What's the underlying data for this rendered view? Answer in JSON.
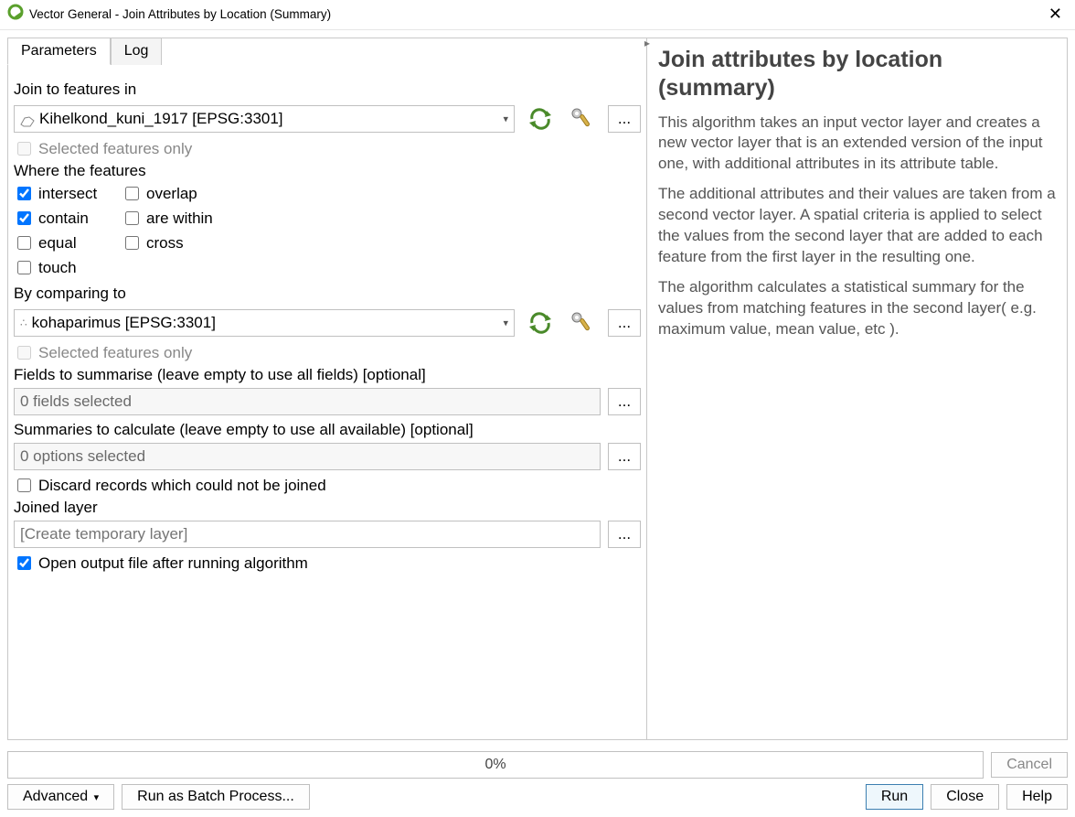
{
  "window": {
    "title": "Vector General - Join Attributes by Location (Summary)"
  },
  "tabs": {
    "parameters": "Parameters",
    "log": "Log",
    "active": "Parameters"
  },
  "left": {
    "join_to_label": "Join to features in",
    "join_to_value": "Kihelkond_kuni_1917 [EPSG:3301]",
    "selected_only_1": "Selected features only",
    "where_label": "Where the features",
    "predicates": {
      "intersect": {
        "label": "intersect",
        "checked": true
      },
      "overlap": {
        "label": "overlap",
        "checked": false
      },
      "contain": {
        "label": "contain",
        "checked": true
      },
      "are_within": {
        "label": "are within",
        "checked": false
      },
      "equal": {
        "label": "equal",
        "checked": false
      },
      "cross": {
        "label": "cross",
        "checked": false
      },
      "touch": {
        "label": "touch",
        "checked": false
      }
    },
    "compare_label": "By comparing to",
    "compare_value": "kohaparimus [EPSG:3301]",
    "selected_only_2": "Selected features only",
    "fields_label": "Fields to summarise (leave empty to use all fields) [optional]",
    "fields_value": "0 fields selected",
    "summaries_label": "Summaries to calculate (leave empty to use all available) [optional]",
    "summaries_value": "0 options selected",
    "discard_label": "Discard records which could not be joined",
    "joined_layer_label": "Joined layer",
    "joined_layer_placeholder": "[Create temporary layer]",
    "open_output_label": "Open output file after running algorithm"
  },
  "right": {
    "title": "Join attributes by location (summary)",
    "p1": "This algorithm takes an input vector layer and creates a new vector layer that is an extended version of the input one, with additional attributes in its attribute table.",
    "p2": "The additional attributes and their values are taken from a second vector layer. A spatial criteria is applied to select the values from the second layer that are added to each feature from the first layer in the resulting one.",
    "p3": "The algorithm calculates a statistical summary for the values from matching features in the second layer( e.g. maximum value, mean value, etc )."
  },
  "bottom": {
    "progress_text": "0%",
    "cancel": "Cancel",
    "advanced": "Advanced",
    "batch": "Run as Batch Process...",
    "run": "Run",
    "close": "Close",
    "help": "Help"
  }
}
